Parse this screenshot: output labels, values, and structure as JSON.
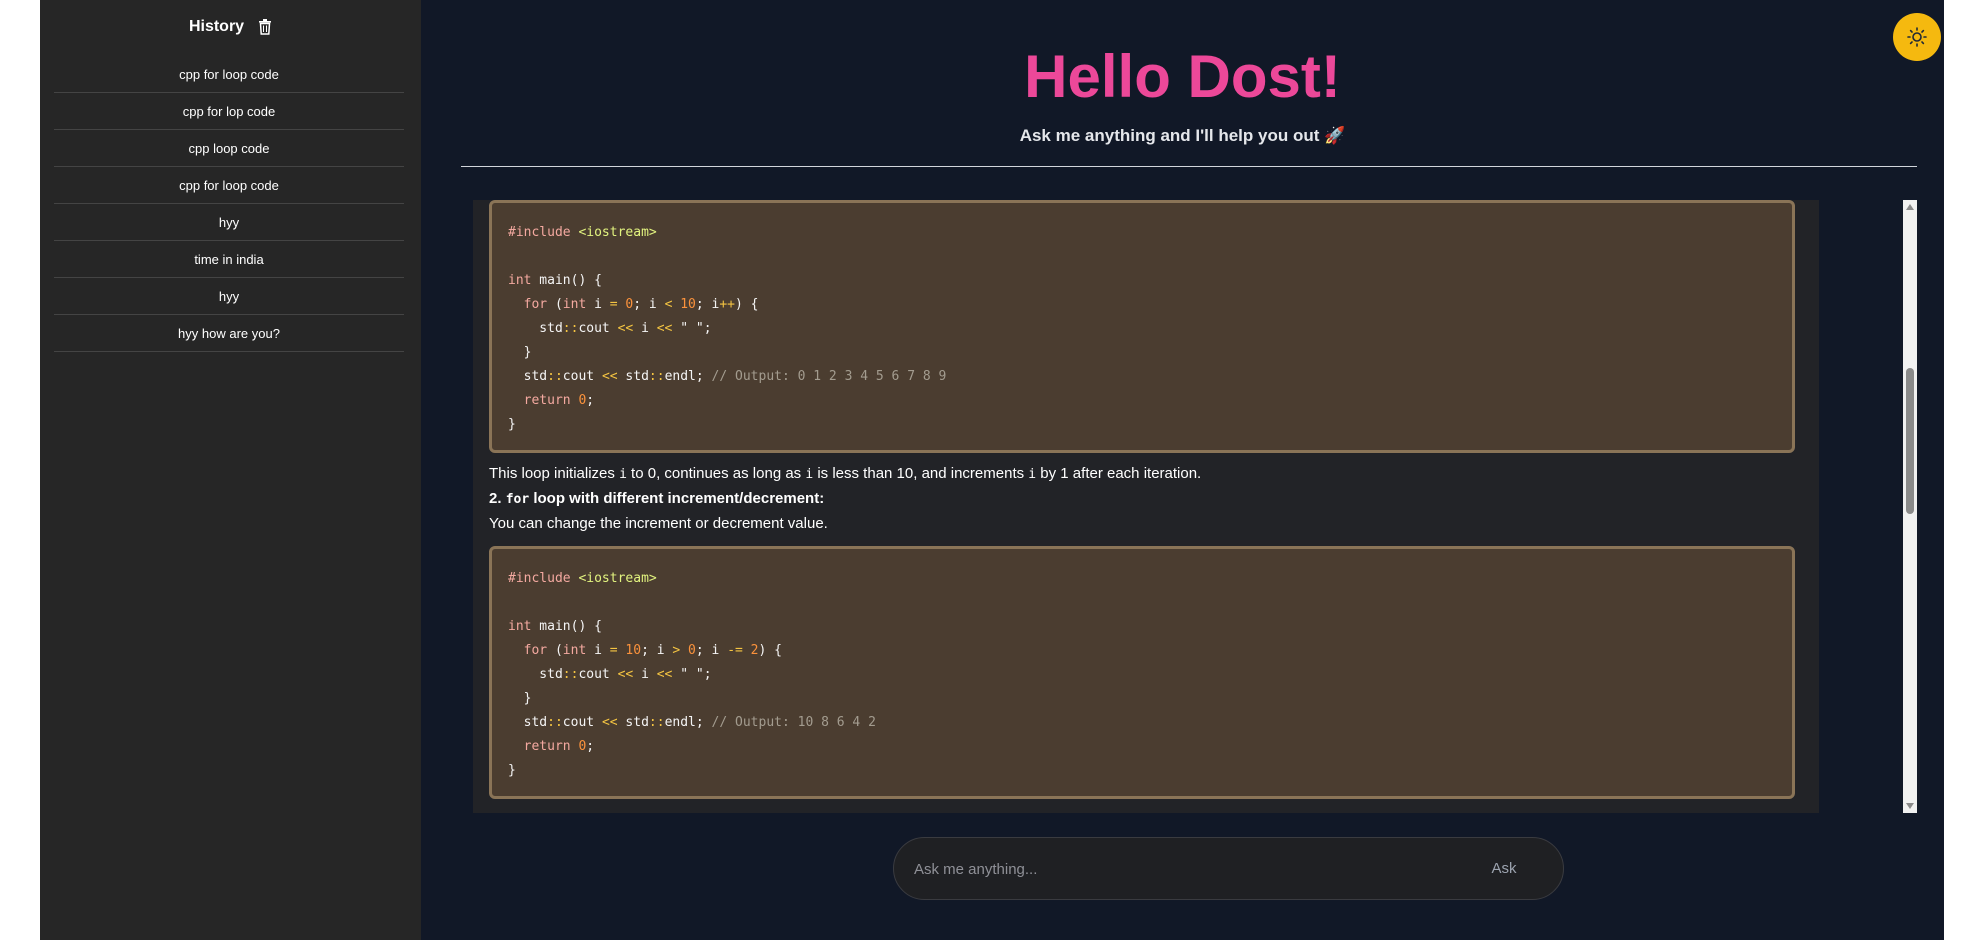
{
  "sidebar": {
    "title": "History",
    "items": [
      {
        "label": "cpp for loop code"
      },
      {
        "label": "cpp for lop code"
      },
      {
        "label": "cpp loop code"
      },
      {
        "label": "cpp for loop code"
      },
      {
        "label": "hyy"
      },
      {
        "label": "time in india"
      },
      {
        "label": "hyy"
      },
      {
        "label": "hyy how are you?"
      }
    ]
  },
  "header": {
    "title": "Hello Dost!",
    "subtitle": "Ask me anything and I'll help you out 🚀"
  },
  "chat": {
    "para1_a": "This loop initializes ",
    "para1_var1": "i",
    "para1_b": " to 0, continues as long as ",
    "para1_var2": "i",
    "para1_c": " is less than 10, and increments ",
    "para1_var3": "i",
    "para1_d": " by 1 after each iteration.",
    "heading2_num": "2. ",
    "heading2_code": "for",
    "heading2_rest": " loop with different increment/decrement:",
    "para3": "You can change the increment or decrement value.",
    "code1_comment": "// Output: 0 1 2 3 4 5 6 7 8 9",
    "code2_comment": "// Output: 10 8 6 4 2"
  },
  "input": {
    "placeholder": "Ask me anything...",
    "button_label": "Ask"
  },
  "colors": {
    "accent": "#ec4899",
    "theme_toggle": "#f5b90f",
    "background": "#111827",
    "sidebar": "#262626"
  },
  "icons": {
    "history_clear": "trash-icon",
    "theme": "sun-icon"
  }
}
